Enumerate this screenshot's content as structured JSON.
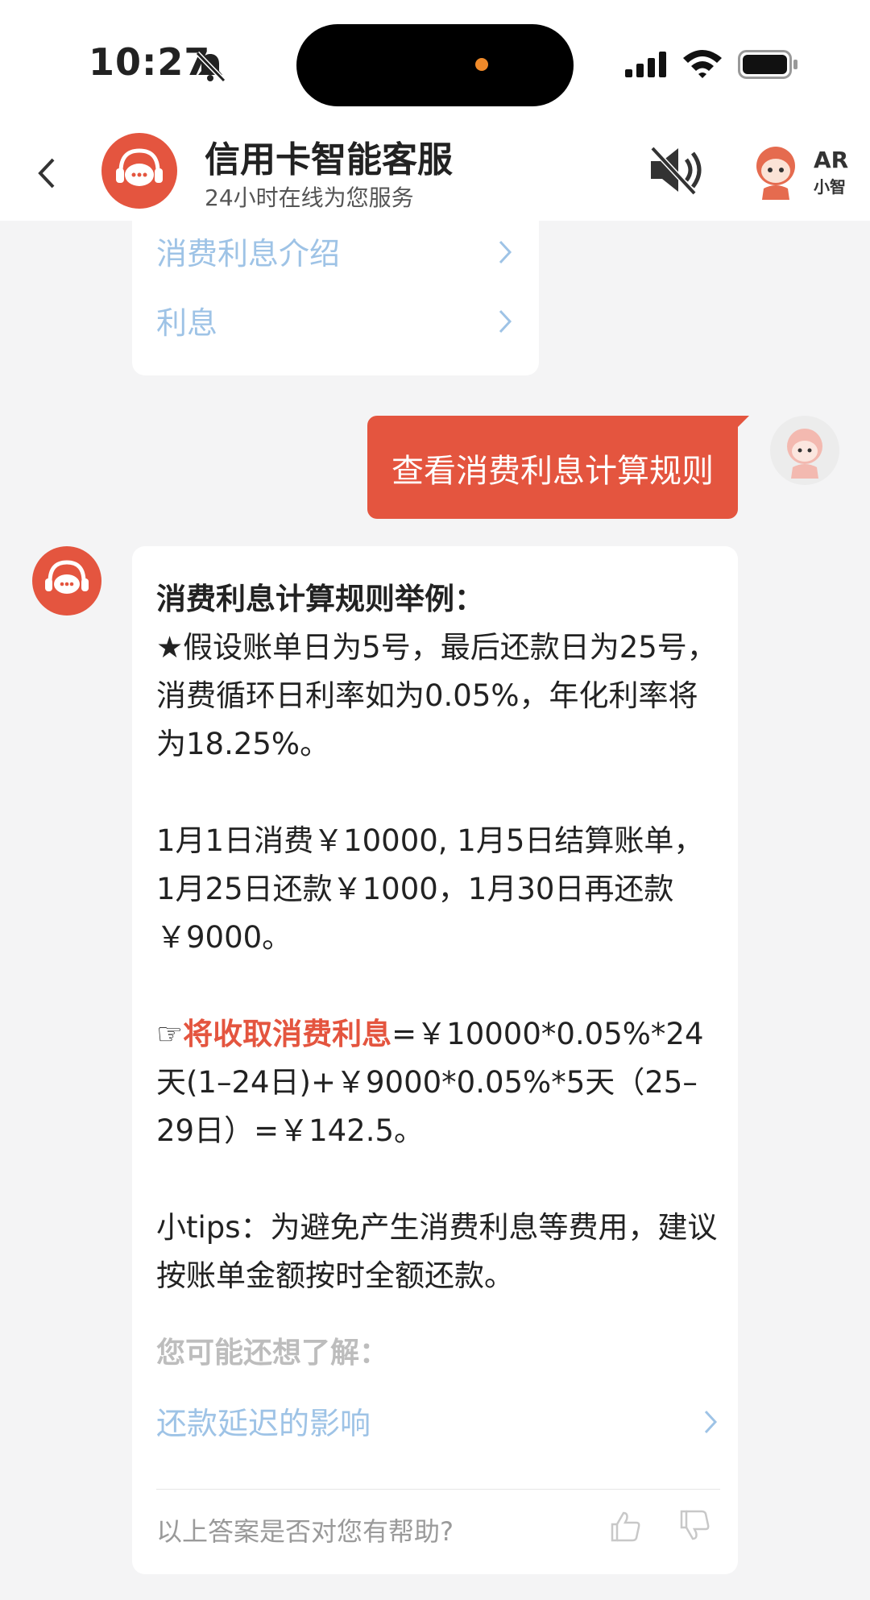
{
  "status_bar": {
    "time": "10:27"
  },
  "header": {
    "title": "信用卡智能客服",
    "subtitle": "24小时在线为您服务",
    "ar_label": "AR",
    "ar_sub": "小智"
  },
  "prev_card": {
    "links": [
      "消费利息介绍",
      "利息"
    ]
  },
  "user_message": {
    "text": "查看消费利息计算规则"
  },
  "answer": {
    "heading": "消费利息计算规则举例：",
    "para1": "★假设账单日为5号，最后还款日为25号，消费循环日利率如为0.05%，年化利率将为18.25%。",
    "para2": "1月1日消费￥10000, 1月5日结算账单，1月25日还款￥1000，1月30日再还款￥9000。",
    "para3_prefix": "☞",
    "para3_highlight": "将收取消费利息",
    "para3_rest": "=￥10000*0.05%*24天(1–24日)+￥9000*0.05%*5天（25–29日）=￥142.5。",
    "para4": "小tips：为避免产生消费利息等费用，建议按账单金额按时全额还款。",
    "more_title": "您可能还想了解：",
    "more_link": "还款延迟的影响",
    "feedback": "以上答案是否对您有帮助?"
  },
  "colors": {
    "accent": "#e4553f",
    "link": "#9ec3e6",
    "background": "#f4f4f5"
  }
}
